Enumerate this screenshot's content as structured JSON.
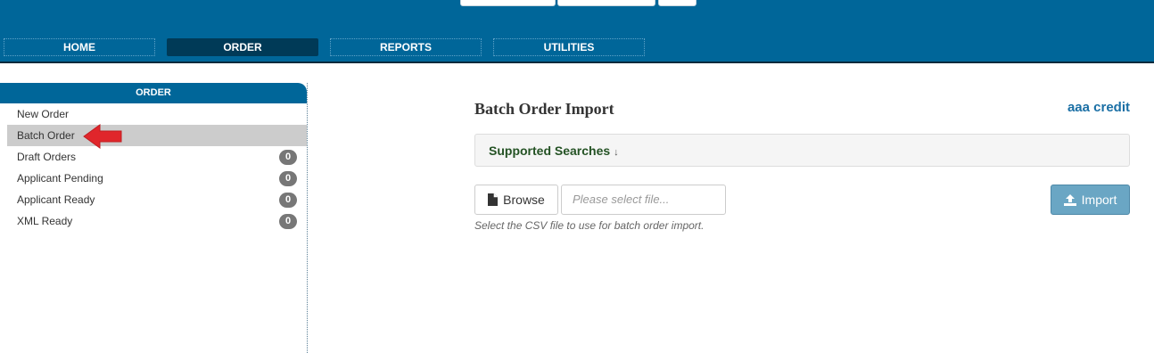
{
  "nav": {
    "tabs": [
      {
        "label": "HOME"
      },
      {
        "label": "ORDER"
      },
      {
        "label": "REPORTS"
      },
      {
        "label": "UTILITIES"
      }
    ],
    "active_tab": "ORDER"
  },
  "sidebar": {
    "header": "ORDER",
    "items": [
      {
        "label": "New Order"
      },
      {
        "label": "Batch Order"
      },
      {
        "label": "Draft Orders",
        "count": "0"
      },
      {
        "label": "Applicant Pending",
        "count": "0"
      },
      {
        "label": "Applicant Ready",
        "count": "0"
      },
      {
        "label": "XML Ready",
        "count": "0"
      }
    ],
    "selected_item": "Batch Order"
  },
  "main": {
    "title": "Batch Order Import",
    "account_link": "aaa credit",
    "panel": {
      "title": "Supported Searches",
      "arrow": "↓"
    },
    "browse_label": "Browse",
    "file_input": {
      "placeholder": "Please select file..."
    },
    "help_text": "Select the CSV file to use for batch order import.",
    "import_label": "Import"
  },
  "colors": {
    "header_bg": "#006699",
    "active_tab_bg": "#003a57",
    "import_bg": "#6aa6c4",
    "annotation_arrow": "#e0262b"
  },
  "icons": {
    "browse": "file-icon",
    "import": "upload-icon",
    "annotation": "red-arrow-icon"
  }
}
